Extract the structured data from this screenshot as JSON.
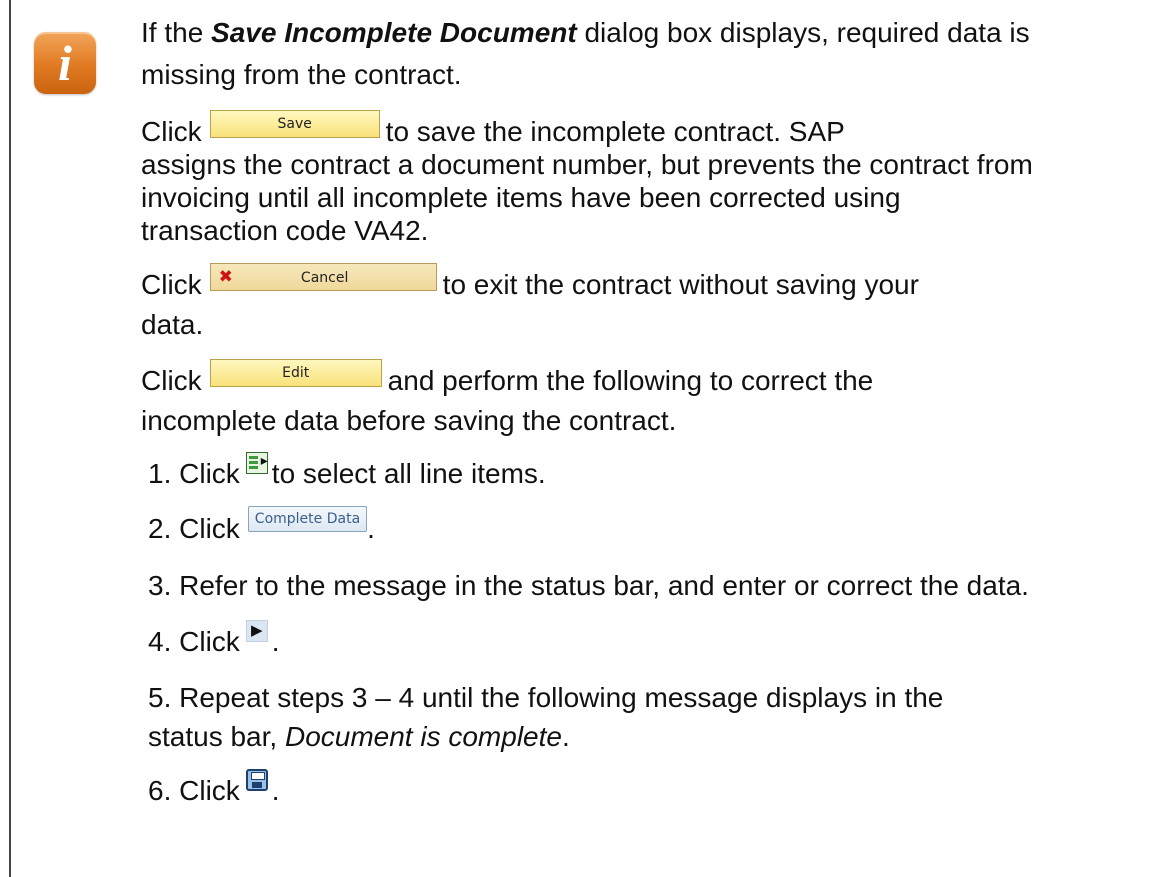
{
  "note": {
    "icon": "info-icon",
    "accent_color": "#e07a22",
    "intro": {
      "prefix": "If the ",
      "emphasis": "Save Incomplete Document",
      "line1_suffix": " dialog box displays, required data is",
      "line2": "missing from the contract."
    },
    "save_para": {
      "click": "Click",
      "button_label": "Save",
      "line1_rest": "to save the incomplete contract. SAP",
      "line2": "assigns the contract a document number, but prevents the contract from",
      "line3": "invoicing until all incomplete items have been corrected using",
      "line4": "transaction code VA42."
    },
    "cancel_para": {
      "click": "Click",
      "button_label": "Cancel",
      "button_icon": "cancel-x-icon",
      "line1_rest": "to exit the contract without saving your",
      "line2": "data."
    },
    "edit_para": {
      "click": "Click",
      "button_label": "Edit",
      "line1_rest": "and perform the following to correct the",
      "line2": "incomplete data before saving the contract."
    },
    "steps": {
      "s1_prefix": "1. Click",
      "s1_icon": "select-all-icon",
      "s1_suffix": "to select all line items.",
      "s2_prefix": "2. Click",
      "s2_button_label": "Complete Data",
      "s2_suffix": ".",
      "s3": "3. Refer to the message in the status bar, and enter or correct the data.",
      "s4_prefix": "4. Click",
      "s4_icon": "next-arrow-icon",
      "s4_suffix": ".",
      "s5_line1": "5. Repeat steps 3 – 4 until the following message displays in the",
      "s5_line2_prefix": "status bar, ",
      "s5_line2_emphasis": "Document is complete",
      "s5_line2_suffix": ".",
      "s6_prefix": "6. Click",
      "s6_icon": "save-disk-icon",
      "s6_suffix": "."
    }
  }
}
